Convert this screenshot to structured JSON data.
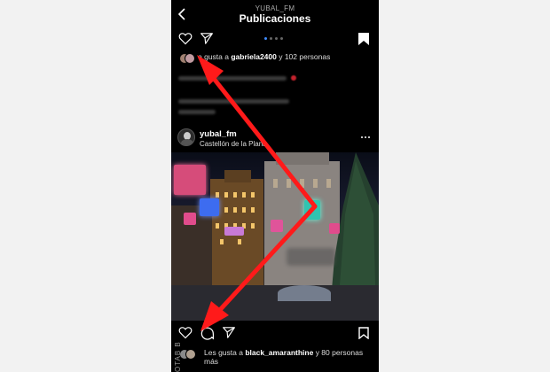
{
  "header": {
    "username": "YUBAL_FM",
    "title": "Publicaciones"
  },
  "post1": {
    "likes_prefix": "e gusta a ",
    "likes_user": "gabriela2400",
    "likes_suffix": " y 102 personas"
  },
  "post2": {
    "username": "yubal_fm",
    "location": "Castellón de la Plana",
    "likes_prefix": "Les gusta a ",
    "likes_user": "black_amaranthine",
    "likes_suffix": " y 80 personas más"
  },
  "side_text": "OTAB B",
  "colors": {
    "background": "#000000",
    "arrow": "#ff1a1a",
    "active_dot": "#3f8cff"
  }
}
